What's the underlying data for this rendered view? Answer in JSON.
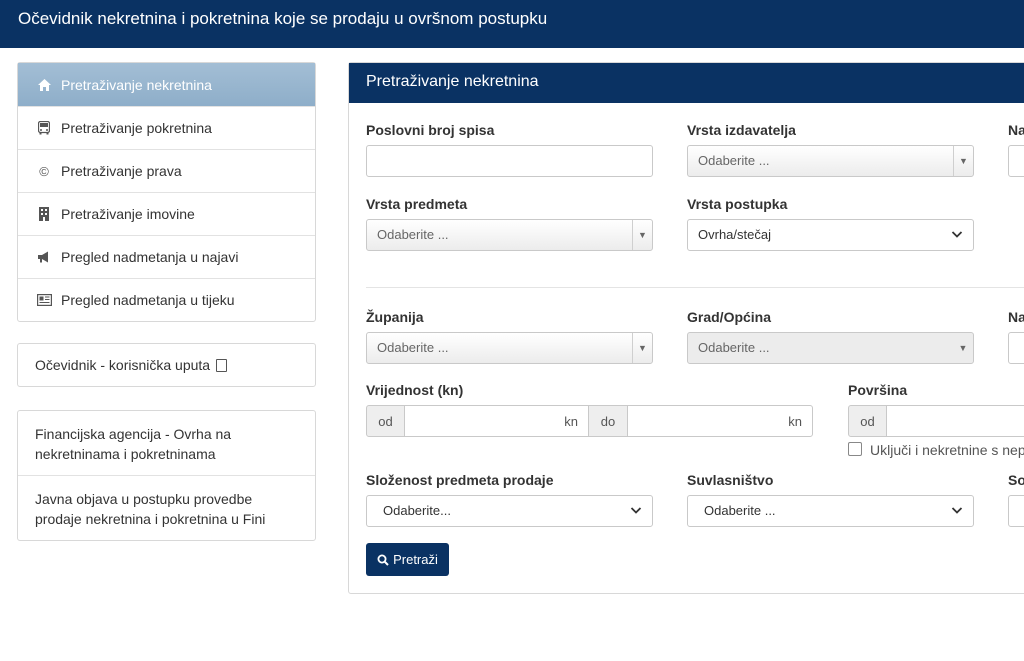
{
  "header": {
    "title": "Očevidnik nekretnina i pokretnina koje se prodaju u ovršnom postupku"
  },
  "sidebar": {
    "items": [
      {
        "label": "Pretraživanje nekretnina",
        "icon": "home-icon"
      },
      {
        "label": "Pretraživanje pokretnina",
        "icon": "bus-icon"
      },
      {
        "label": "Pretraživanje prava",
        "icon": "copyright-icon"
      },
      {
        "label": "Pretraživanje imovine",
        "icon": "building-icon"
      },
      {
        "label": "Pregled nadmetanja u najavi",
        "icon": "megaphone-icon"
      },
      {
        "label": "Pregled nadmetanja u tijeku",
        "icon": "newspaper-icon"
      }
    ],
    "manual_label": "Očevidnik - korisnička uputa",
    "links": [
      "Financijska agencija - Ovrha na nekretninama i pokretninama",
      "Javna objava u postupku provedbe prodaje nekretnina i pokretnina u Fini"
    ]
  },
  "panel": {
    "title": "Pretraživanje nekretnina",
    "case_number_label": "Poslovni broj spisa",
    "issuer_type_label": "Vrsta izdavatelja",
    "issuer_type_placeholder": "Odaberite ...",
    "cut_label_1": "Na",
    "subject_type_label": "Vrsta predmeta",
    "subject_type_placeholder": "Odaberite ...",
    "procedure_type_label": "Vrsta postupka",
    "procedure_type_value": "Ovrha/stečaj",
    "county_label": "Županija",
    "county_placeholder": "Odaberite ...",
    "city_label": "Grad/Općina",
    "city_placeholder": "Odaberite ...",
    "cut_label_2": "Na",
    "value_label": "Vrijednost (kn)",
    "from": "od",
    "to": "do",
    "unit": "kn",
    "area_label": "Površina",
    "area_from": "od",
    "include_label": "Uključi i nekretnine s nepo",
    "complexity_label": "Složenost predmeta prodaje",
    "complexity_value": "Odaberite...",
    "coownership_label": "Suvlasništvo",
    "coownership_value": "Odaberite ...",
    "cut_label_3": "So",
    "search_button": "Pretraži"
  }
}
